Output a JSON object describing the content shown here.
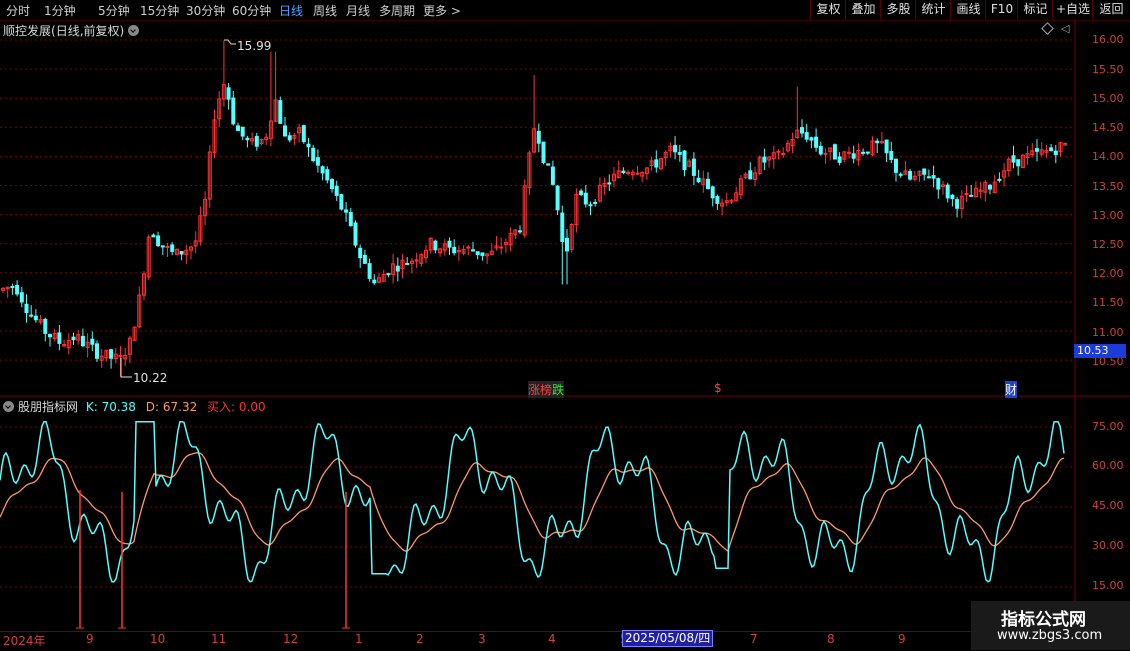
{
  "toolbar": {
    "periods": [
      "分时",
      "1分钟",
      "5分钟",
      "15分钟",
      "30分钟",
      "60分钟",
      "日线",
      "周线",
      "月线",
      "多周期",
      "更多 >"
    ],
    "active_period": "日线",
    "buttons": [
      "复权",
      "叠加",
      "多股",
      "统计",
      "画线",
      "F10",
      "标记",
      "+自选",
      "返回"
    ]
  },
  "main_chart": {
    "stock_name": "顺控发展",
    "mode": "(日线,前复权)",
    "high_label": "15.99",
    "low_label": "10.22",
    "current_price": "10.53",
    "y_ticks": [
      "16.00",
      "15.50",
      "15.00",
      "14.50",
      "14.00",
      "13.50",
      "13.00",
      "12.50",
      "12.00",
      "11.50",
      "11.00",
      "10.50"
    ],
    "events": {
      "limit_up": "涨",
      "limit_board": "榜",
      "limit_down": "跌",
      "dollar": "$",
      "finance": "财"
    }
  },
  "indicator": {
    "name": "股朋指标网",
    "k_label": "K: 70.38",
    "d_label": "D: 67.32",
    "buy_label": "买入: 0.00",
    "y_ticks": [
      "75.00",
      "60.00",
      "45.00",
      "30.00",
      "15.00"
    ]
  },
  "date_axis": {
    "months": [
      "2024年",
      "9",
      "10",
      "11",
      "12",
      "1",
      "2",
      "3",
      "4",
      "5",
      "6",
      "7",
      "8",
      "9"
    ],
    "cursor_date": "2025/05/08/四"
  },
  "watermark": {
    "line1": "指标公式网",
    "line2": "www.zbgs3.com"
  },
  "colors": {
    "up": "#ff3333",
    "down": "#54ffff",
    "k_line": "#54ffff",
    "d_line": "#ff9966",
    "grid": "#7a0000",
    "buy": "#ff3333"
  },
  "chart_data": {
    "type": "line",
    "price_range": [
      10.22,
      15.99
    ],
    "kd_range": [
      15,
      75
    ]
  }
}
